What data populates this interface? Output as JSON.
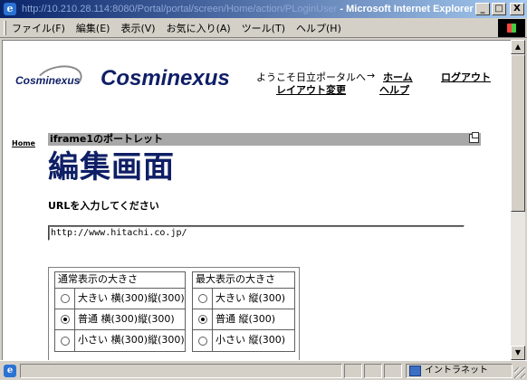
{
  "window": {
    "url": "http://10.210.28.114:8080/Portal/portal/screen/Home/action/PLoginUser",
    "title": " - Microsoft Internet Explorer",
    "minimize": "_",
    "maximize": "□",
    "close": "X"
  },
  "menu": {
    "items": [
      "ファイル(F)",
      "編集(E)",
      "表示(V)",
      "お気に入り(A)",
      "ツール(T)",
      "ヘルプ(H)"
    ]
  },
  "header": {
    "logo_small": "Cosminexus",
    "logo_big": "Cosminexus",
    "welcome": "ようこそ日立ポータルへ",
    "arrow": "→",
    "home_link": "ホーム",
    "logout_link": "ログアウト",
    "layout_link": "レイアウト変更",
    "help_link": "ヘルプ"
  },
  "sidebar": {
    "home": "Home"
  },
  "portlet": {
    "title": "iframe1のポートレット",
    "heading": "編集画面",
    "url_prompt": "URLを入力してください",
    "url_value": "http://www.hitachi.co.jp/"
  },
  "size_table": {
    "normal_header": "通常表示の大きさ",
    "max_header": "最大表示の大きさ",
    "normal_options": [
      {
        "label": "大きい 横(300)縦(300)",
        "checked": false
      },
      {
        "label": "普通 横(300)縦(300)",
        "checked": true
      },
      {
        "label": "小さい 横(300)縦(300)",
        "checked": false
      }
    ],
    "max_options": [
      {
        "label": "大きい 縦(300)",
        "checked": false
      },
      {
        "label": "普通 縦(300)",
        "checked": true
      },
      {
        "label": "小さい 縦(300)",
        "checked": false
      }
    ]
  },
  "status": {
    "zone": "イントラネット"
  }
}
